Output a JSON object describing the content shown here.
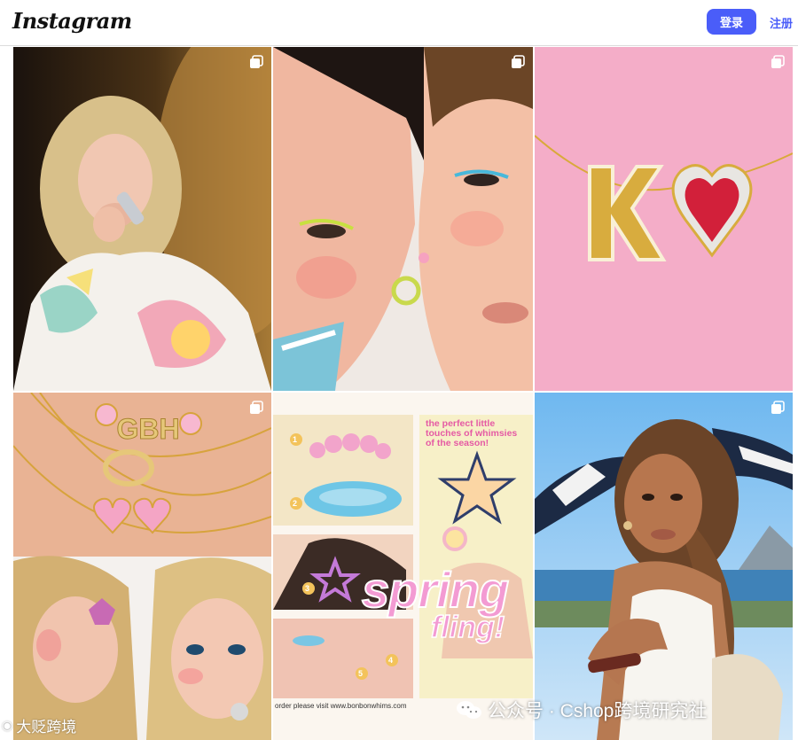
{
  "header": {
    "logo": "Instagram",
    "login_label": "登录",
    "signup_label": "注册"
  },
  "posts": [
    {
      "id": "post-singer",
      "icon": "multi-photo-icon"
    },
    {
      "id": "post-makeup",
      "icon": "multi-photo-icon"
    },
    {
      "id": "post-necklace-k",
      "icon": "multi-photo-icon"
    },
    {
      "id": "post-gbh-necklaces",
      "icon": "multi-photo-icon"
    },
    {
      "id": "post-spring-fling",
      "icon": "none"
    },
    {
      "id": "post-beach-model",
      "icon": "multi-photo-icon"
    }
  ],
  "spring_collage": {
    "headline": "the perfect little touches of whimsies of the season!",
    "big_word_1": "spring",
    "big_word_2": "fling!",
    "numbers": [
      "1",
      "2",
      "3",
      "4",
      "5"
    ],
    "footer": "order please visit www.bonbonwhims.com"
  },
  "necklace_letters": "GBH",
  "watermarks": {
    "left": "大贬跨境",
    "right": "公众号 · Cshop跨境研究社"
  },
  "colors": {
    "accent": "#4a5df9",
    "header_border": "#dbdbdb"
  }
}
